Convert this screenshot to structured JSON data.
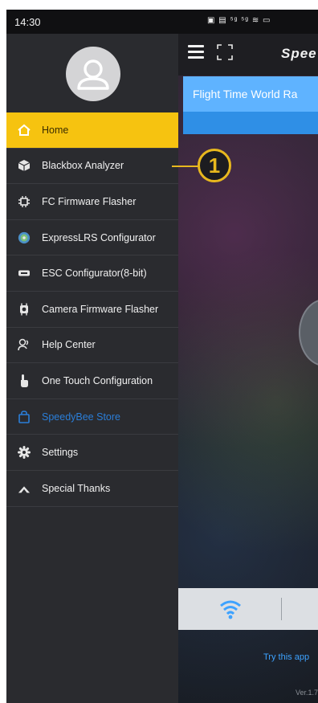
{
  "status_bar": {
    "time": "14:30",
    "icons": "▣ ▤ ⁵ᵍ ⁵ᵍ ≋ ▭"
  },
  "app": {
    "brand": "Spee",
    "banner_text": "Flight Time World Ra",
    "try_text": "Try this app",
    "version_text": "Ver.1.7"
  },
  "drawer": {
    "items": [
      {
        "label": "Home",
        "icon": "home-icon"
      },
      {
        "label": "Blackbox Analyzer",
        "icon": "cube-icon"
      },
      {
        "label": "FC Firmware Flasher",
        "icon": "chip-icon"
      },
      {
        "label": "ExpressLRS Configurator",
        "icon": "elrs-icon"
      },
      {
        "label": "ESC Configurator(8-bit)",
        "icon": "esc-icon"
      },
      {
        "label": "Camera Firmware Flasher",
        "icon": "camera-chip-icon"
      },
      {
        "label": "Help Center",
        "icon": "help-icon"
      },
      {
        "label": "One Touch Configuration",
        "icon": "touch-icon"
      },
      {
        "label": "SpeedyBee Store",
        "icon": "store-bag-icon"
      },
      {
        "label": "Settings",
        "icon": "gear-icon"
      },
      {
        "label": "Special Thanks",
        "icon": "thanks-icon"
      }
    ]
  },
  "callout": {
    "number": "1"
  },
  "colors": {
    "active": "#f6c310",
    "store": "#2a7ed8",
    "banner": "#5fb3ff",
    "callout": "#e8b81e"
  }
}
